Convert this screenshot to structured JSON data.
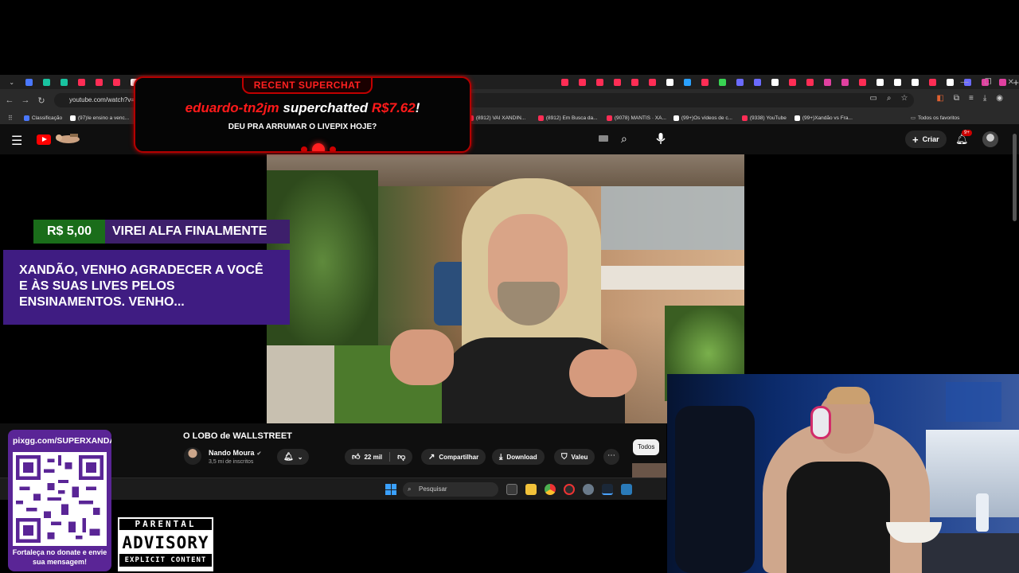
{
  "browser": {
    "tabs": [
      {
        "favicon_color": "#4a78ff"
      },
      {
        "favicon_color": "#19c3a0"
      },
      {
        "favicon_color": "#19c3a0"
      },
      {
        "favicon_color": "#ff2d55"
      },
      {
        "favicon_color": "#ff2d55"
      },
      {
        "favicon_color": "#ff2d55"
      },
      {
        "favicon_color": "#ffffff"
      },
      {
        "favicon_color": "#ff2d55"
      },
      {
        "favicon_color": "#ff2d55"
      },
      {
        "favicon_color": "#ffffff"
      },
      {
        "favicon_color": "#ff2d55"
      }
    ],
    "tabs_right": [
      {
        "favicon_color": "#ff2d55"
      },
      {
        "favicon_color": "#ff2d55"
      },
      {
        "favicon_color": "#ff2d55"
      },
      {
        "favicon_color": "#ff2d55"
      },
      {
        "favicon_color": "#ff2d55"
      },
      {
        "favicon_color": "#ff2d55"
      },
      {
        "favicon_color": "#ffffff"
      },
      {
        "favicon_color": "#2aa1ff"
      },
      {
        "favicon_color": "#ff2d55"
      },
      {
        "favicon_color": "#39d353"
      },
      {
        "favicon_color": "#6b6bff"
      },
      {
        "favicon_color": "#6b6bff"
      },
      {
        "favicon_color": "#ffffff"
      },
      {
        "favicon_color": "#ff2d55"
      },
      {
        "favicon_color": "#ff2d55"
      },
      {
        "favicon_color": "#e040a0"
      },
      {
        "favicon_color": "#e040a0"
      },
      {
        "favicon_color": "#ff2d55"
      },
      {
        "favicon_color": "#ffffff"
      },
      {
        "favicon_color": "#ffffff"
      },
      {
        "favicon_color": "#ffffff"
      },
      {
        "favicon_color": "#ff2d55"
      },
      {
        "favicon_color": "#ffffff"
      },
      {
        "favicon_color": "#6b6bff"
      },
      {
        "favicon_color": "#e040a0"
      },
      {
        "favicon_color": "#e040a0"
      }
    ],
    "url": "youtube.com/watch?v=x",
    "bookmarks": [
      {
        "label": "Classificação",
        "favicon_color": "#4a78ff"
      },
      {
        "label": "(97)Ie ensino a venc...",
        "favicon_color": "#ffffff"
      },
      {
        "label": "(8912) VAI XANDIN...",
        "favicon_color": "#ff2d55"
      },
      {
        "label": "(8912) Em Busca da...",
        "favicon_color": "#ff2d55"
      },
      {
        "label": "(9078) MANTIS · XA...",
        "favicon_color": "#ff2d55"
      },
      {
        "label": "(99+)Os vídeos de c...",
        "favicon_color": "#ffffff"
      },
      {
        "label": "(9338) YouTube",
        "favicon_color": "#ff2d55"
      },
      {
        "label": "(99+)Xandão vs Fra...",
        "favicon_color": "#ffffff"
      }
    ],
    "all_favorites": "Todos os favoritos"
  },
  "youtube": {
    "create_label": "Criar",
    "notifications": "9+",
    "video_title": "O LOBO de WALLSTREET",
    "channel_name": "Nando Moura",
    "subscribers": "3,5 mi de inscritos",
    "likes": "22 mil",
    "share_label": "Compartilhar",
    "download_label": "Download",
    "thanks_label": "Valeu",
    "chip_all": "Todos",
    "brand_color": "#ff0000"
  },
  "superchat": {
    "header": "RECENT SUPERCHAT",
    "user": "eduardo-tn2jm",
    "verb": "superchatted",
    "amount": "R$7.62",
    "exclaim": "!",
    "message": "DEU PRA ARRUMAR O LIVEPIX HOJE?"
  },
  "donation": {
    "amount": "R$ 5,00",
    "name": "VIREI ALFA FINALMENTE",
    "message": "XANDÃO, VENHO AGRADECER A VOCÊ E ÀS SUAS LIVES PELOS ENSINAMENTOS. VENHO..."
  },
  "taskbar": {
    "search_placeholder": "Pesquisar"
  },
  "qr": {
    "url": "pixgg.com/SUPERXANDA",
    "caption": "Fortaleça no donate e envie sua mensagem!"
  },
  "advisory": {
    "top": "PARENTAL",
    "middle": "ADVISORY",
    "bottom": "EXPLICIT CONTENT"
  }
}
